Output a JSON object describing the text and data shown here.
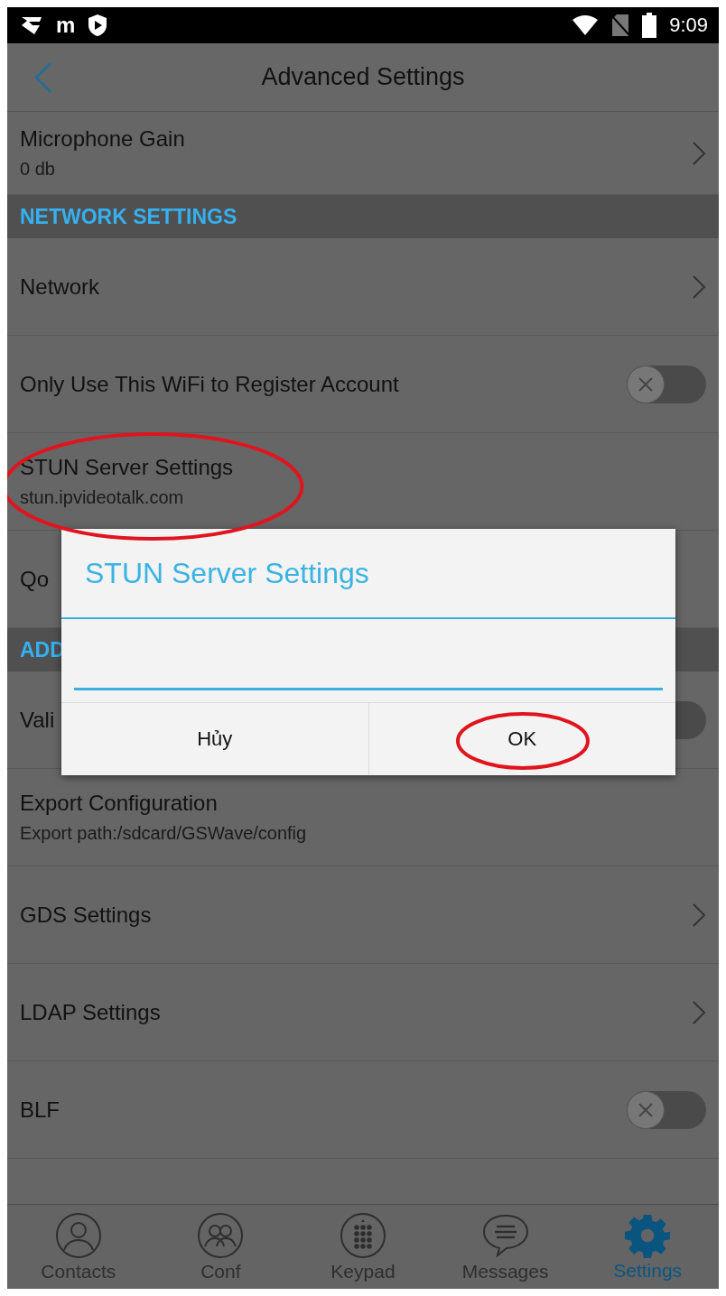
{
  "status_bar": {
    "notification_letter": "m",
    "time": "9:09"
  },
  "header": {
    "title": "Advanced Settings"
  },
  "settings": [
    {
      "kind": "chevron",
      "title": "Microphone Gain",
      "subtitle": "0 db"
    },
    {
      "kind": "section",
      "title": "NETWORK SETTINGS"
    },
    {
      "kind": "chevron",
      "title": "Network"
    },
    {
      "kind": "toggle",
      "title": "Only Use This WiFi to Register Account",
      "on": false
    },
    {
      "kind": "plain",
      "title": "STUN Server Settings",
      "subtitle": "stun.ipvideotalk.com"
    },
    {
      "kind": "plain",
      "title": "Qo"
    },
    {
      "kind": "section",
      "title": "ADD"
    },
    {
      "kind": "toggle",
      "title": "Vali",
      "on": false
    },
    {
      "kind": "plain",
      "title": "Export Configuration",
      "subtitle": "Export path:/sdcard/GSWave/config"
    },
    {
      "kind": "chevron",
      "title": "GDS Settings"
    },
    {
      "kind": "chevron",
      "title": "LDAP Settings"
    },
    {
      "kind": "toggle",
      "title": "BLF",
      "on": false
    }
  ],
  "dialog": {
    "title": "STUN Server Settings",
    "buttons": [
      "Hủy",
      "OK"
    ]
  },
  "nav": [
    {
      "kind": "contacts",
      "label": "Contacts",
      "selected": false
    },
    {
      "kind": "conf",
      "label": "Conf",
      "selected": false
    },
    {
      "kind": "keypad",
      "label": "Keypad",
      "selected": false
    },
    {
      "kind": "messages",
      "label": "Messages",
      "selected": false
    },
    {
      "kind": "settings",
      "label": "Settings",
      "selected": true
    }
  ]
}
